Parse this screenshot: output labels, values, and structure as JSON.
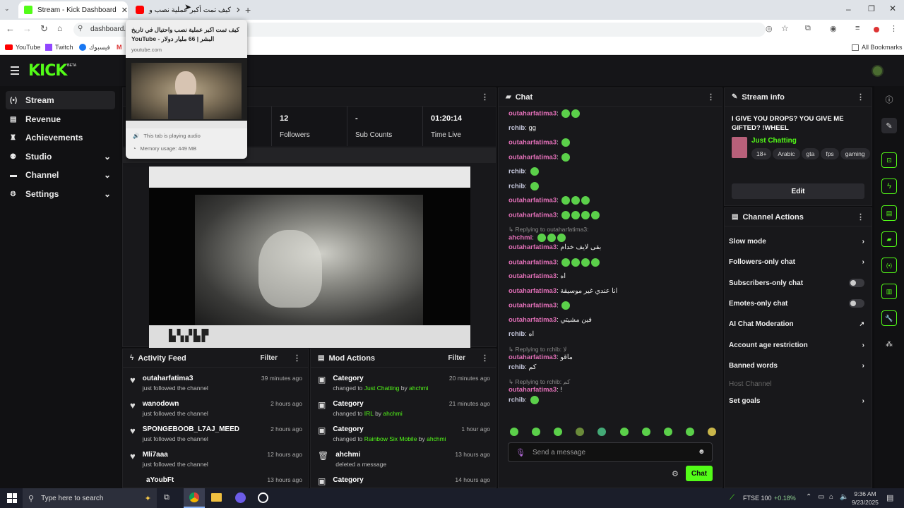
{
  "browser": {
    "tabs": [
      {
        "title": "Stream - Kick Dashboard",
        "active": true
      },
      {
        "title": "كيف تمت أكبر عملية نصب و",
        "active": false
      }
    ],
    "address": "dashboard.k",
    "bookmarks": [
      "YouTube",
      "Twitch",
      "فيسبوك",
      "M"
    ],
    "all_bookmarks": "All Bookmarks"
  },
  "tab_popup": {
    "title": "كيف تمت اكبر عملية نصب واحتيال في تاريخ البشر | 66 مليار دولار - YouTube",
    "domain": "youtube.com",
    "playing": "This tab is playing audio",
    "memory": "Memory usage: 449 MB"
  },
  "app": {
    "logo": "KICK",
    "beta": "BETA",
    "nav": [
      {
        "label": "Stream",
        "active": true,
        "expand": false
      },
      {
        "label": "Revenue",
        "active": false,
        "expand": false
      },
      {
        "label": "Achievements",
        "active": false,
        "expand": false
      },
      {
        "label": "Studio",
        "active": false,
        "expand": true
      },
      {
        "label": "Channel",
        "active": false,
        "expand": true
      },
      {
        "label": "Settings",
        "active": false,
        "expand": true
      }
    ]
  },
  "stats": [
    {
      "value": "12",
      "label": "Followers"
    },
    {
      "value": "-",
      "label": "Sub Counts"
    },
    {
      "value": "01:20:14",
      "label": "Time Live"
    }
  ],
  "activity_feed": {
    "title": "Activity Feed",
    "filter": "Filter",
    "items": [
      {
        "user": "outaharfatima3",
        "action": "just followed the channel",
        "time": "39 minutes ago"
      },
      {
        "user": "wanodown",
        "action": "just followed the channel",
        "time": "2 hours ago"
      },
      {
        "user": "SPONGEBOOB_L7AJ_MEED",
        "action": "just followed the channel",
        "time": "2 hours ago"
      },
      {
        "user": "Mli7aaa",
        "action": "just followed the channel",
        "time": "12 hours ago"
      },
      {
        "user": "aYoubFt",
        "action": "",
        "time": "13 hours ago"
      }
    ]
  },
  "mod_actions": {
    "title": "Mod Actions",
    "filter": "Filter",
    "items": [
      {
        "title": "Category",
        "pre": "changed to ",
        "target": "Just Chatting",
        "mid": " by ",
        "by": "ahchmi",
        "time": "20 minutes ago"
      },
      {
        "title": "Category",
        "pre": "changed to ",
        "target": "IRL",
        "mid": " by ",
        "by": "ahchmi",
        "time": "21 minutes ago"
      },
      {
        "title": "Category",
        "pre": "changed to ",
        "target": "Rainbow Six Mobile",
        "mid": " by ",
        "by": "ahchmi",
        "time": "1 hour ago"
      },
      {
        "title": "ahchmi",
        "pre": "deleted a message",
        "target": "",
        "mid": "",
        "by": "",
        "time": "13 hours ago"
      },
      {
        "title": "Category",
        "pre": "",
        "target": "",
        "mid": "",
        "by": "",
        "time": "14 hours ago"
      }
    ]
  },
  "chat": {
    "title": "Chat",
    "placeholder": "Send a message",
    "send": "Chat",
    "messages": [
      {
        "user": "outaharfatima3",
        "text": "",
        "emotes": 2
      },
      {
        "user": "rchib",
        "text": "gg",
        "emotes": 0
      },
      {
        "user": "outaharfatima3",
        "text": "",
        "emotes": 1
      },
      {
        "user": "outaharfatima3",
        "text": "",
        "emotes": 1
      },
      {
        "user": "rchib",
        "text": "",
        "emotes": 1
      },
      {
        "user": "rchib",
        "text": "",
        "emotes": 1
      },
      {
        "user": "outaharfatima3",
        "text": "",
        "emotes": 3
      },
      {
        "user": "outaharfatima3",
        "text": "",
        "emotes": 4
      },
      {
        "reply": "Replying to outaharfatima3:",
        "user": "ahchmi",
        "text": "",
        "emotes": 3
      },
      {
        "user": "outaharfatima3",
        "text": "بقى لايف خدام",
        "emotes": 0
      },
      {
        "user": "outaharfatima3",
        "text": "",
        "emotes": 4
      },
      {
        "user": "outaharfatima3",
        "text": "اه",
        "emotes": 0
      },
      {
        "user": "outaharfatima3",
        "text": "انا عندي غير موسيقة",
        "emotes": 0
      },
      {
        "user": "outaharfatima3",
        "text": "",
        "emotes": 1
      },
      {
        "user": "outaharfatima3",
        "text": "فين مشيتي",
        "emotes": 0
      },
      {
        "user": "rchib",
        "text": "اه",
        "emotes": 0
      },
      {
        "reply": "Replying to rchib: لا",
        "user": "outaharfatima3",
        "text": "ماقو",
        "emotes": 0
      },
      {
        "user": "rchib",
        "text": "كم",
        "emotes": 0
      },
      {
        "reply": "Replying to rchib: كم",
        "user": "outaharfatima3",
        "text": "!",
        "emotes": 0
      },
      {
        "user": "rchib",
        "text": "",
        "emotes": 1
      }
    ]
  },
  "stream_info": {
    "title": "Stream info",
    "stream_title": "I GIVE YOU DROPS? YOU GIVE ME GIFTED? !WHEEL",
    "category": "Just Chatting",
    "tags": [
      "18+",
      "Arabic",
      "gta",
      "fps",
      "gaming"
    ],
    "edit": "Edit"
  },
  "channel_actions": {
    "title": "Channel Actions",
    "items": [
      {
        "label": "Slow mode",
        "kind": "chevron"
      },
      {
        "label": "Followers-only chat",
        "kind": "chevron"
      },
      {
        "label": "Subscribers-only chat",
        "kind": "toggle"
      },
      {
        "label": "Emotes-only chat",
        "kind": "toggle"
      },
      {
        "label": "AI Chat Moderation",
        "kind": "external"
      },
      {
        "label": "Account age restriction",
        "kind": "chevron"
      },
      {
        "label": "Banned words",
        "kind": "chevron"
      },
      {
        "label": "Host Channel",
        "kind": "disabled"
      },
      {
        "label": "Set goals",
        "kind": "chevron"
      }
    ]
  },
  "taskbar": {
    "search": "Type here to search",
    "ticker": "FTSE 100",
    "ticker_change": "+0.18%",
    "time": "9:36 AM",
    "date": "9/23/2025"
  },
  "colors": {
    "accent": "#53fc18",
    "username": "#e16fb7",
    "panel": "#18181b"
  }
}
